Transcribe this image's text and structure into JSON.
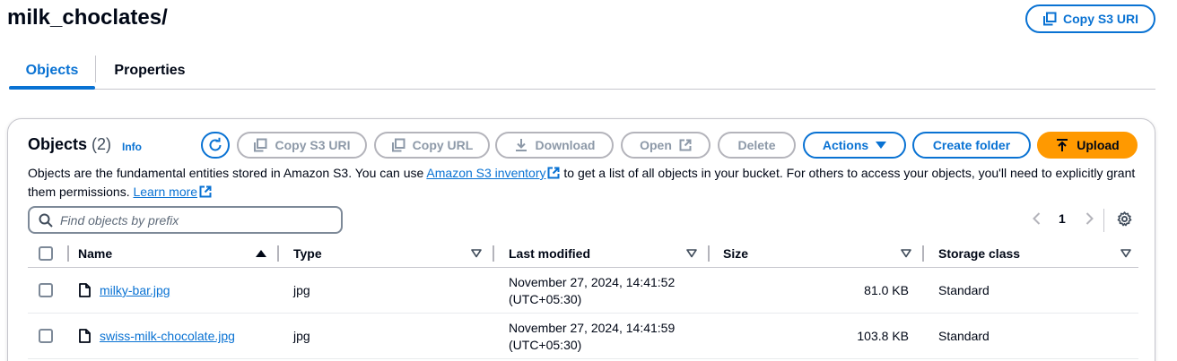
{
  "header": {
    "title": "milk_choclates/",
    "copy_s3_uri": "Copy S3 URI"
  },
  "tabs": [
    {
      "label": "Objects",
      "active": true
    },
    {
      "label": "Properties",
      "active": false
    }
  ],
  "objects_panel": {
    "title": "Objects",
    "count": "(2)",
    "info": "Info",
    "buttons": {
      "copy_s3_uri": "Copy S3 URI",
      "copy_url": "Copy URL",
      "download": "Download",
      "open": "Open",
      "delete": "Delete",
      "actions": "Actions",
      "create_folder": "Create folder",
      "upload": "Upload"
    },
    "description": {
      "part1": "Objects are the fundamental entities stored in Amazon S3. You can use ",
      "inventory_link": "Amazon S3 inventory",
      "part2": " to get a list of all objects in your bucket. For others to access your objects, you'll need to explicitly grant them permissions. ",
      "learn_more": "Learn more"
    },
    "search": {
      "placeholder": "Find objects by prefix",
      "value": ""
    },
    "pagination": {
      "current_page": "1"
    },
    "table": {
      "columns": [
        "Name",
        "Type",
        "Last modified",
        "Size",
        "Storage class"
      ],
      "rows": [
        {
          "name": "milky-bar.jpg",
          "type": "jpg",
          "modified_line1": "November 27, 2024, 14:41:52",
          "modified_line2": "(UTC+05:30)",
          "size": "81.0 KB",
          "storage_class": "Standard"
        },
        {
          "name": "swiss-milk-chocolate.jpg",
          "type": "jpg",
          "modified_line1": "November 27, 2024, 14:41:59",
          "modified_line2": "(UTC+05:30)",
          "size": "103.8 KB",
          "storage_class": "Standard"
        }
      ]
    }
  },
  "colors": {
    "accent": "#0972d3",
    "primary_button": "#ff9900",
    "disabled": "#8d99a8",
    "text": "#000716"
  },
  "icons": {
    "copy": "copy-icon",
    "refresh": "refresh-icon",
    "download": "download-icon",
    "external": "external-link-icon",
    "caret": "caret-down-icon",
    "upload": "upload-icon",
    "search": "search-icon",
    "settings": "gear-icon",
    "file": "file-icon"
  }
}
